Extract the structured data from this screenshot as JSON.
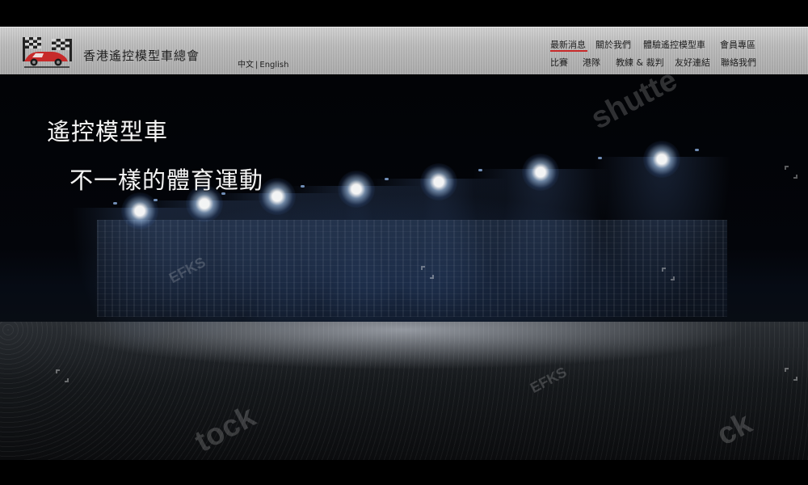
{
  "header": {
    "org_name": "香港遙控模型車總會",
    "lang": {
      "zh": "中文",
      "separator": "|",
      "en": "English"
    },
    "nav_row1": [
      "最新消息",
      "關於我們",
      "體驗遙控模型車",
      "會員專區"
    ],
    "nav_row2": [
      "比賽",
      "港隊",
      "教練 & 裁判",
      "友好連結",
      "聯絡我們"
    ],
    "active_item": "最新消息",
    "accent_color": "#c72a2a"
  },
  "hero": {
    "title": "遙控模型車",
    "subtitle": "不一樣的體育運動"
  },
  "watermarks": {
    "shutterstock": "shutte",
    "efks": "EFKS",
    "stock_fragment_1": "tock",
    "stock_fragment_2": "ck"
  },
  "icons": {
    "logo": "checkered-flag-car-logo",
    "corner_marks": "watermark-bracket-icon"
  }
}
